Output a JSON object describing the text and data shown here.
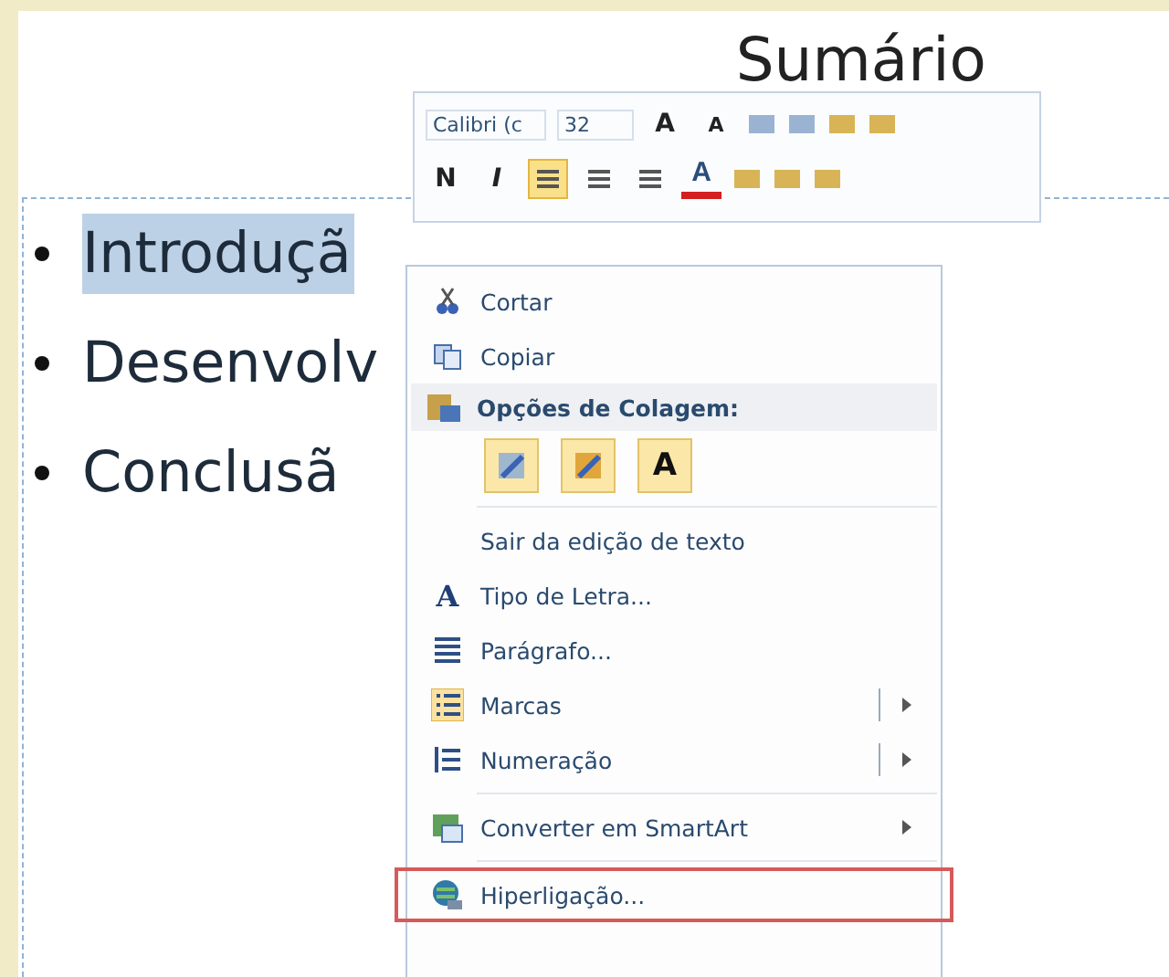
{
  "slide": {
    "title": "Sumário",
    "bullets": [
      {
        "text": "Introduçã",
        "selected": true
      },
      {
        "text": "Desenvolv",
        "selected": false
      },
      {
        "text": "Conclusã",
        "selected": false
      }
    ]
  },
  "mini_toolbar": {
    "font": "Calibri (c",
    "size": "32",
    "row1": [
      {
        "kind": "grow",
        "label": "A"
      },
      {
        "kind": "shrink",
        "label": "A"
      },
      {
        "kind": "icon"
      },
      {
        "kind": "icon"
      },
      {
        "kind": "icon"
      },
      {
        "kind": "icon"
      }
    ],
    "row2": [
      {
        "kind": "bold",
        "label": "N",
        "selected": false
      },
      {
        "kind": "italic",
        "label": "I",
        "selected": false
      },
      {
        "kind": "align",
        "selected": true
      },
      {
        "kind": "align",
        "selected": false
      },
      {
        "kind": "align",
        "selected": false
      },
      {
        "kind": "color",
        "label": "A"
      },
      {
        "kind": "icon"
      },
      {
        "kind": "icon"
      },
      {
        "kind": "icon"
      }
    ]
  },
  "context_menu": [
    {
      "kind": "item",
      "label": "Cortar"
    },
    {
      "kind": "item",
      "label": "Copiar"
    },
    {
      "kind": "header",
      "label": "Opções de Colagem:"
    },
    {
      "kind": "paste",
      "options": [
        {
          "kind": "icon"
        },
        {
          "kind": "icon"
        },
        {
          "kind": "text",
          "label": "A"
        }
      ]
    },
    {
      "kind": "separator"
    },
    {
      "kind": "item",
      "label": "Sair da edição de texto"
    },
    {
      "kind": "item",
      "label": "Tipo de Letra...",
      "glyph": "A"
    },
    {
      "kind": "item",
      "label": "Parágrafo..."
    },
    {
      "kind": "item",
      "label": "Marcas",
      "submenu": true,
      "split": true
    },
    {
      "kind": "item",
      "label": "Numeração",
      "submenu": true,
      "split": true
    },
    {
      "kind": "separator"
    },
    {
      "kind": "item",
      "label": "Converter em SmartArt",
      "submenu": true
    },
    {
      "kind": "separator"
    },
    {
      "kind": "item",
      "label": "Hiperligação...",
      "outlined": true
    }
  ]
}
